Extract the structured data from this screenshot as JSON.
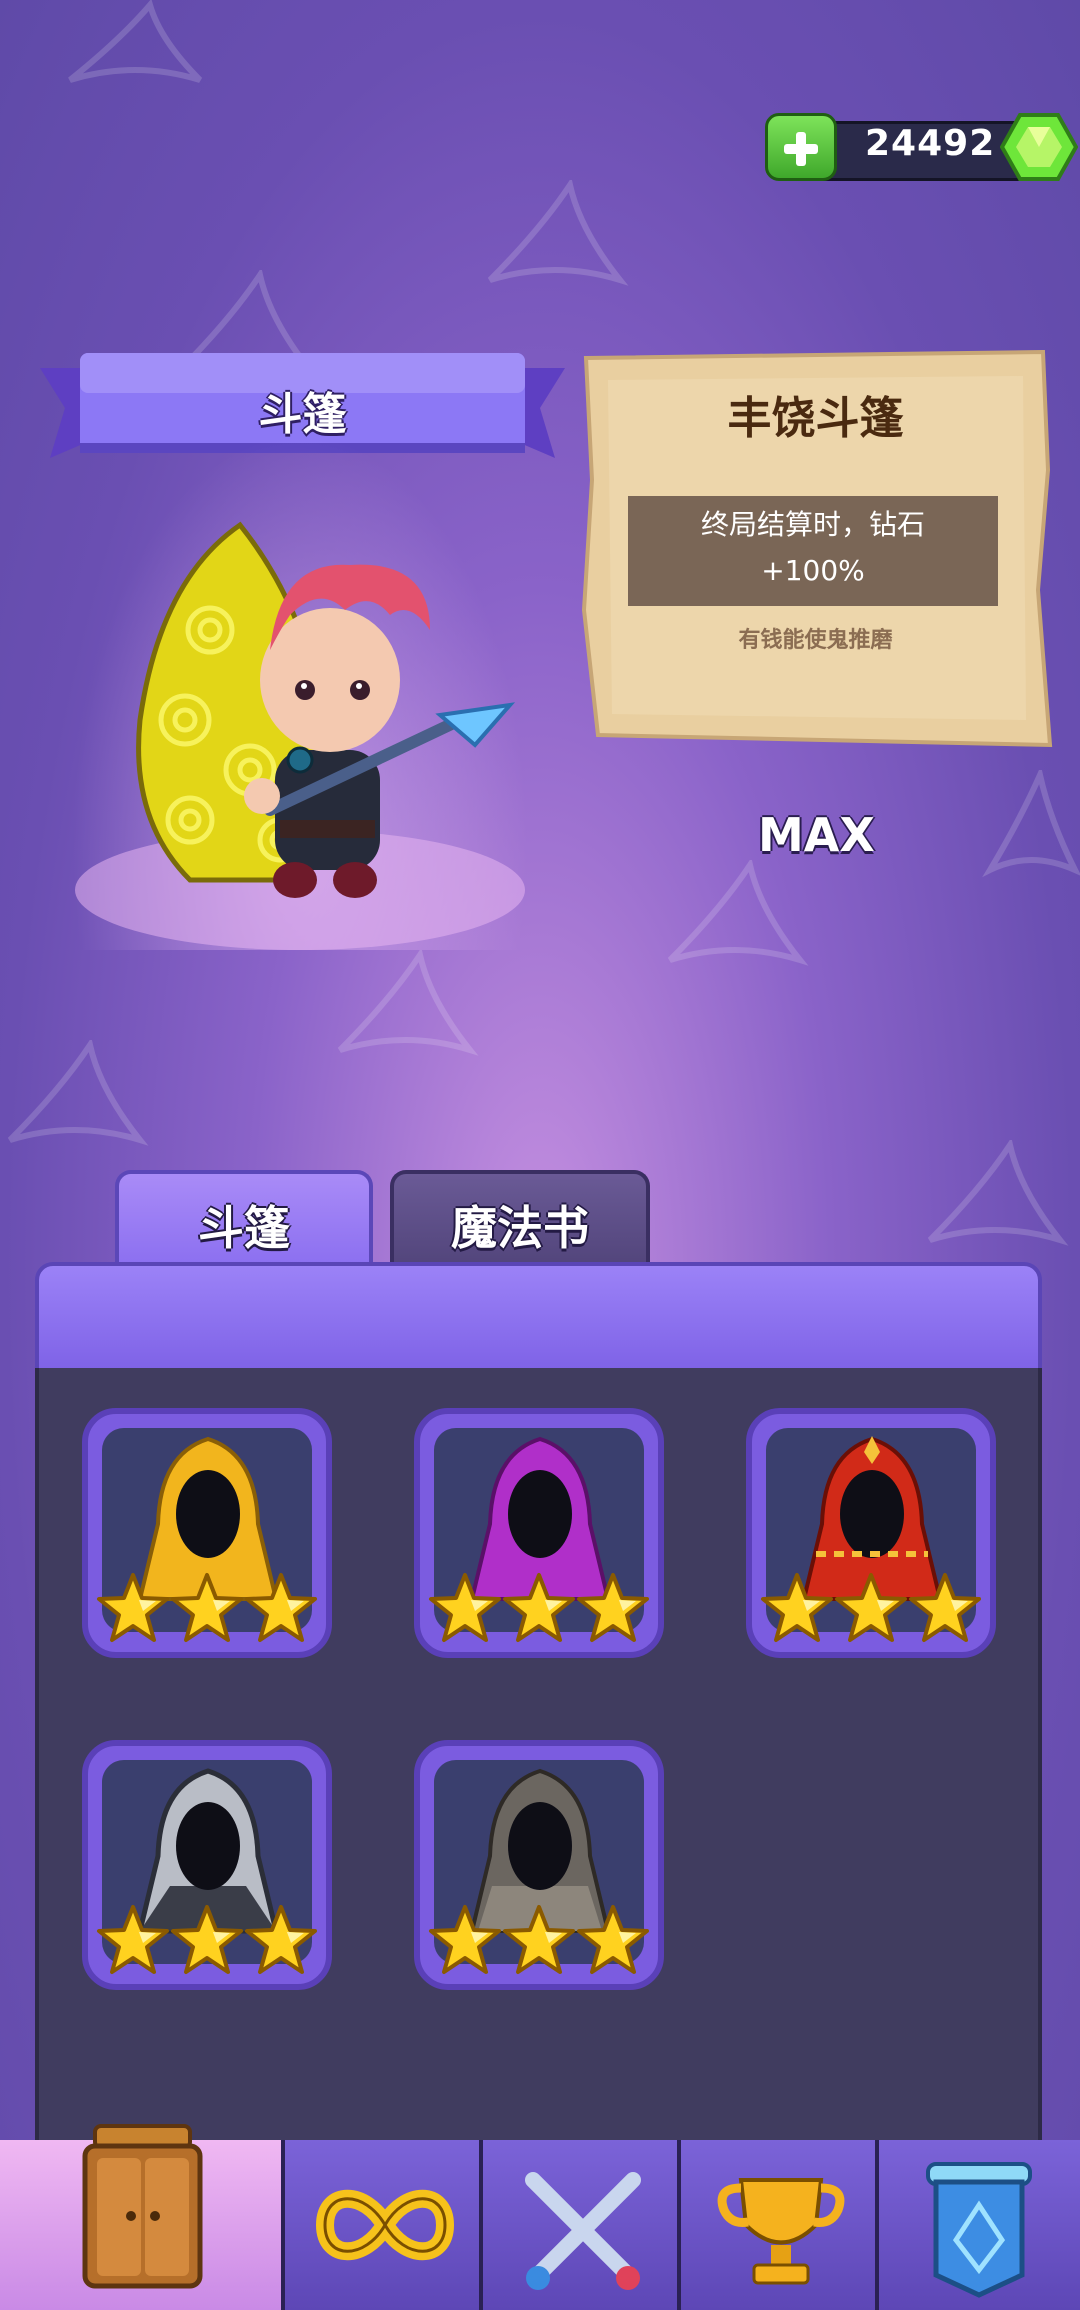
{
  "currency": {
    "amount": "24492",
    "icon": "green-gem-icon",
    "add_icon": "plus-icon"
  },
  "header": {
    "category_title": "斗篷"
  },
  "item": {
    "name": "丰饶斗篷",
    "description_line1": "终局结算时，钻石",
    "description_line2": "+100%",
    "flavor": "有钱能使鬼推磨",
    "level_label": "MAX"
  },
  "tabs": [
    {
      "label": "斗篷",
      "active": true
    },
    {
      "label": "魔法书",
      "active": false
    }
  ],
  "cloaks": [
    {
      "icon": "gold-cloak-icon",
      "color": "#f2b51d",
      "stars": 3
    },
    {
      "icon": "purple-cloak-icon",
      "color": "#b02fc9",
      "stars": 3
    },
    {
      "icon": "red-cloak-icon",
      "color": "#d12a18",
      "stars": 3
    },
    {
      "icon": "grey-cloak-icon",
      "color": "#b9bdc6",
      "stars": 3
    },
    {
      "icon": "stone-cloak-icon",
      "color": "#6b6660",
      "stars": 3
    }
  ],
  "bottom_nav": [
    {
      "icon": "wardrobe-icon",
      "active": true
    },
    {
      "icon": "infinity-icon",
      "active": false
    },
    {
      "icon": "crossed-swords-icon",
      "active": false
    },
    {
      "icon": "trophy-icon",
      "active": false
    },
    {
      "icon": "banner-icon",
      "active": false
    }
  ]
}
